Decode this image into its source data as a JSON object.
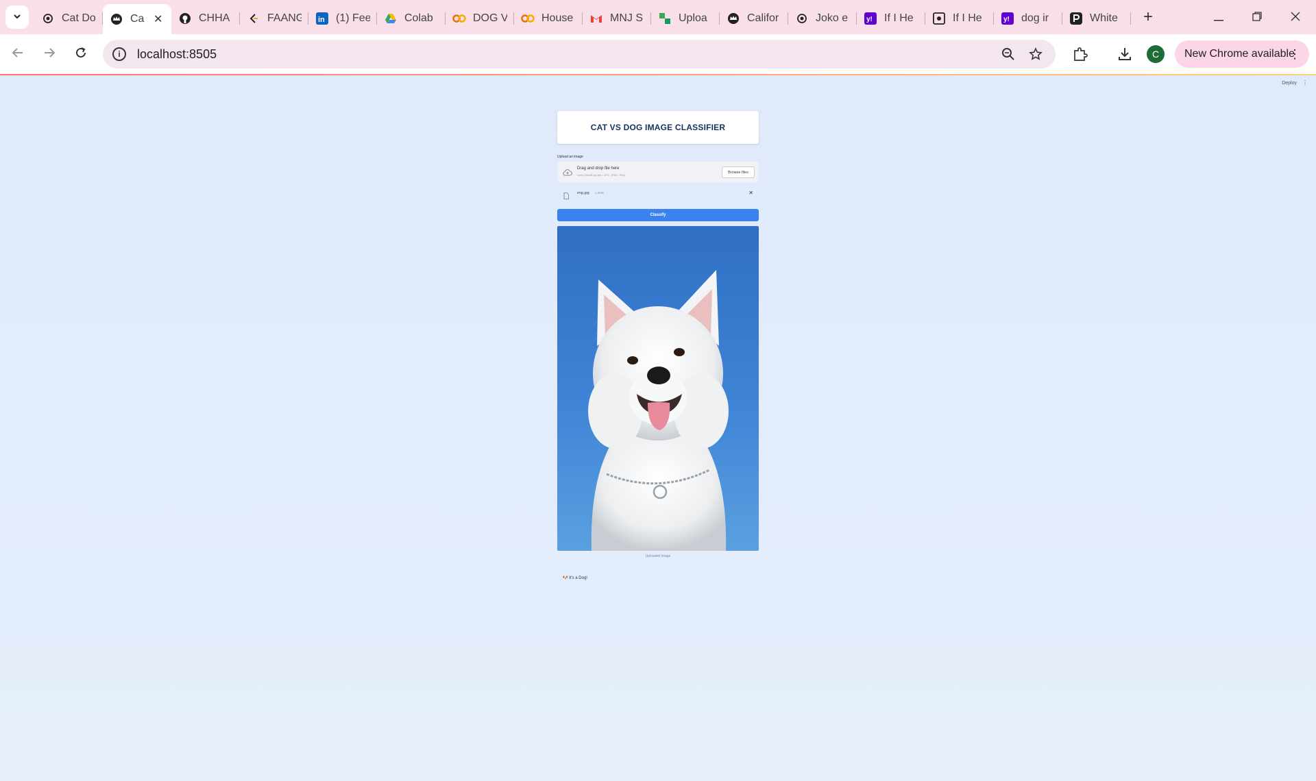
{
  "browser": {
    "tabs": [
      {
        "label": "Cat Do",
        "icon": "openai-icon",
        "active": false
      },
      {
        "label": "Ca",
        "icon": "streamlit-crown-icon",
        "active": true
      },
      {
        "label": "CHHA",
        "icon": "github-icon",
        "active": false
      },
      {
        "label": "FAANG",
        "icon": "leetcode-icon",
        "active": false
      },
      {
        "label": "(1) Fee",
        "icon": "linkedin-icon",
        "active": false
      },
      {
        "label": "Colab",
        "icon": "google-drive-icon",
        "active": false
      },
      {
        "label": "DOG V",
        "icon": "colab-icon",
        "active": false
      },
      {
        "label": "House",
        "icon": "colab-icon",
        "active": false
      },
      {
        "label": "MNJ S",
        "icon": "gmail-icon",
        "active": false
      },
      {
        "label": "Uploa",
        "icon": "upload-app-icon",
        "active": false
      },
      {
        "label": "Califor",
        "icon": "streamlit-crown-icon",
        "active": false
      },
      {
        "label": "Joko e",
        "icon": "openai-icon",
        "active": false
      },
      {
        "label": "If I He",
        "icon": "yahoo-icon",
        "active": false
      },
      {
        "label": "If I He",
        "icon": "ai-site-icon",
        "active": false
      },
      {
        "label": "dog ir",
        "icon": "yahoo-icon",
        "active": false
      },
      {
        "label": "White",
        "icon": "pexels-icon",
        "active": false
      }
    ],
    "url": "localhost:8505",
    "profile_initial": "C",
    "update_label": "New Chrome available"
  },
  "app": {
    "deploy_label": "Deploy",
    "title": "CAT VS DOG IMAGE CLASSIFIER",
    "upload_label": "Upload an image",
    "dropzone_title": "Drag and drop file here",
    "dropzone_sub": "Limit 200MB per file • JPG, JPEG, PNG",
    "browse_label": "Browse files",
    "file_name": "img.jpg",
    "file_size": "1.0MB",
    "classify_label": "Classify",
    "image_caption": "Uploaded Image",
    "result_text": "🐶 It's a Dog!"
  },
  "colors": {
    "accent": "#3b82f0",
    "tabstrip": "#f9dfea",
    "page_bg": "#e4eefb",
    "title_text": "#14315e"
  }
}
